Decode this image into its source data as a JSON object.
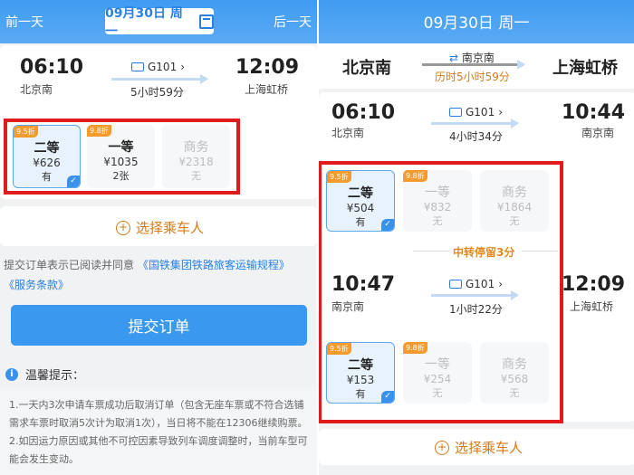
{
  "left": {
    "prev_day": "前一天",
    "date": "09月30日 周一",
    "next_day": "后一天",
    "depart_time": "06:10",
    "depart_station": "北京南",
    "train_no": "G101",
    "duration": "5小时59分",
    "arrive_time": "12:09",
    "arrive_station": "上海虹桥",
    "seats": [
      {
        "badge": "9.5折",
        "name": "二等",
        "price": "¥626",
        "avail": "有"
      },
      {
        "badge": "9.8折",
        "name": "一等",
        "price": "¥1035",
        "avail": "2张"
      },
      {
        "name": "商务",
        "price": "¥2318",
        "avail": "无"
      }
    ],
    "add_passenger": "选择乘车人",
    "agreement_prefix": "提交订单表示已阅读并同意",
    "agreement_link1": "《国铁集团铁路旅客运输规程》",
    "agreement_link2": "《服务条款》",
    "submit": "提交订单",
    "tips_title": "温馨提示：",
    "tips": [
      "1.一天内3次申请车票成功后取消订单（包含无座车票或不符合选铺需求车票时取消5次计为取消1次），当日将不能在12306继续购票。",
      "2.如因运力原因或其他不可控因素导致列车调度调整时，当前车型可能会发生变动。"
    ]
  },
  "right": {
    "date": "09月30日 周一",
    "from": "北京南",
    "via": "南京南",
    "total_duration": "历时5小时59分",
    "to": "上海虹桥",
    "leg1": {
      "depart_time": "06:10",
      "depart_station": "北京南",
      "train_no": "G101",
      "duration": "4小时34分",
      "arrive_time": "10:44",
      "arrive_station": "南京南",
      "seats": [
        {
          "badge": "9.5折",
          "name": "二等",
          "price": "¥504",
          "avail": "有"
        },
        {
          "badge": "9.8折",
          "name": "一等",
          "price": "¥832",
          "avail": "无"
        },
        {
          "name": "商务",
          "price": "¥1864",
          "avail": "无"
        }
      ]
    },
    "transfer": "中转停留3分",
    "leg2": {
      "depart_time": "10:47",
      "depart_station": "南京南",
      "train_no": "G101",
      "duration": "1小时22分",
      "arrive_time": "12:09",
      "arrive_station": "上海虹桥",
      "seats": [
        {
          "badge": "9.5折",
          "name": "二等",
          "price": "¥153",
          "avail": "有"
        },
        {
          "badge": "9.8折",
          "name": "一等",
          "price": "¥254",
          "avail": "无"
        },
        {
          "name": "商务",
          "price": "¥568",
          "avail": "无"
        }
      ]
    },
    "add_passenger": "选择乘车人"
  },
  "colors": {
    "accent": "#3b98ef",
    "highlight_box": "#e01b1b",
    "discount_badge": "#f59b2e",
    "add_passenger": "#d47a18"
  }
}
